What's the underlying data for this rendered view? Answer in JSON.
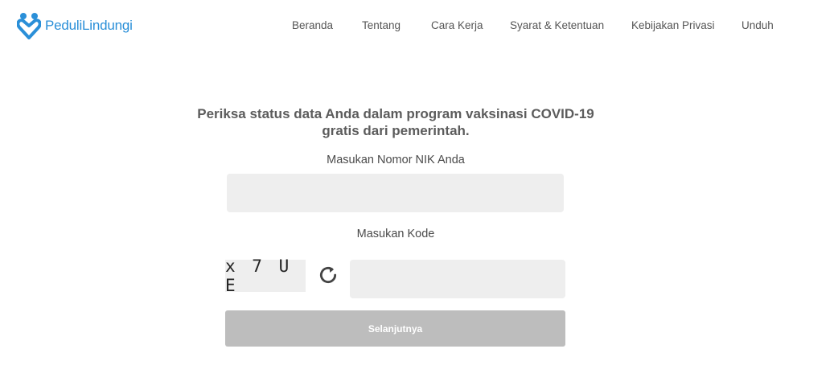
{
  "header": {
    "brand": "PeduliLindungi",
    "nav": [
      "Beranda",
      "Tentang",
      "Cara Kerja",
      "Syarat & Ketentuan",
      "Kebijakan Privasi",
      "Unduh"
    ]
  },
  "form": {
    "title": "Periksa status data Anda dalam program vaksinasi COVID-19 gratis dari pemerintah.",
    "nik_label": "Masukan Nomor NIK Anda",
    "nik_value": "",
    "code_label": "Masukan Kode",
    "captcha_text": "x 7 U E",
    "code_value": "",
    "submit_label": "Selanjutnya"
  },
  "colors": {
    "brand": "#2a8fd8",
    "button_disabled": "#bdbdbd",
    "input_bg": "#eeeeee"
  }
}
